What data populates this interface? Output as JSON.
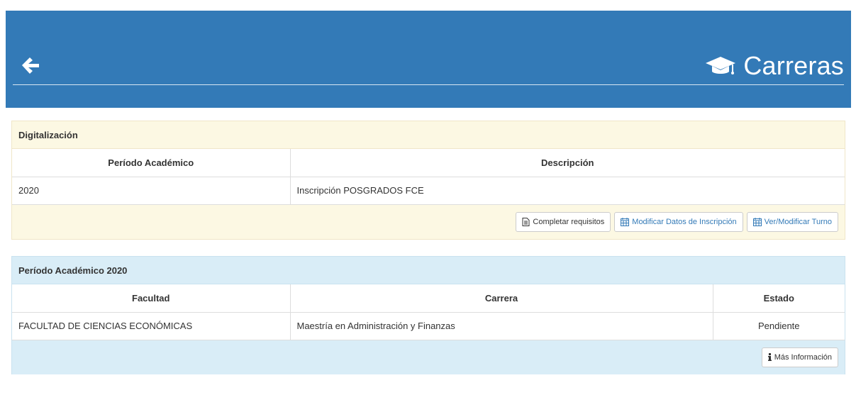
{
  "header": {
    "title": "Carreras",
    "back_icon": "arrow-left-icon",
    "title_icon": "graduation-cap-icon",
    "bg_color": "#337ab7"
  },
  "digitalizacion": {
    "heading": "Digitalización",
    "columns": [
      "Período Académico",
      "Descripción"
    ],
    "rows": [
      {
        "periodo": "2020",
        "descripcion": "Inscripción POSGRADOS FCE"
      }
    ],
    "buttons": {
      "completar": "Completar requisitos",
      "modificar": "Modificar Datos de Inscripción",
      "turno": "Ver/Modificar Turno"
    }
  },
  "periodo": {
    "heading": "Período Académico 2020",
    "columns": [
      "Facultad",
      "Carrera",
      "Estado"
    ],
    "rows": [
      {
        "facultad": "FACULTAD DE CIENCIAS ECONÓMICAS",
        "carrera": "Maestría en Administración y Finanzas",
        "estado": "Pendiente"
      }
    ],
    "buttons": {
      "info": "Más Información"
    }
  }
}
